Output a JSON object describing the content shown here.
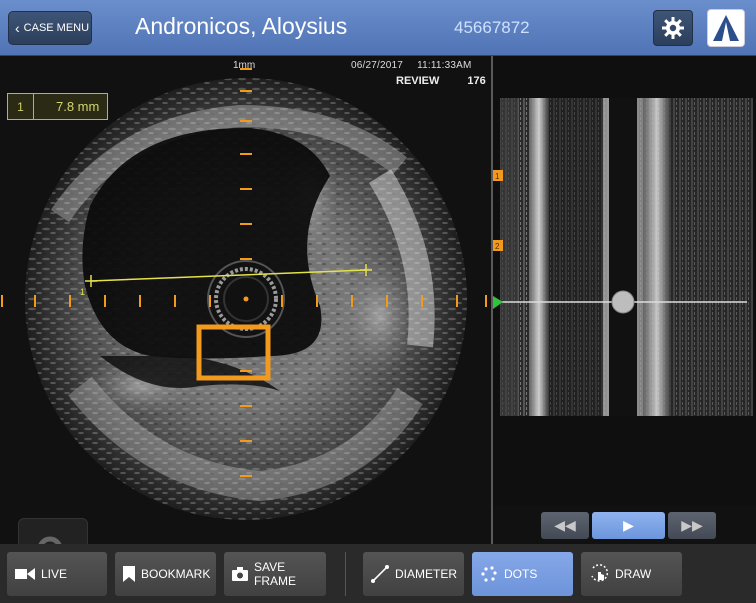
{
  "header": {
    "back_label": "CASE MENU",
    "patient_name": "Andronicos, Aloysius",
    "patient_id": "45667872"
  },
  "ivus": {
    "scale_label": "1mm",
    "date": "06/27/2017",
    "time": "11:11:33AM",
    "mode": "REVIEW",
    "frame": "176",
    "measurement": {
      "index": "1",
      "value": "7.8 mm"
    },
    "diameter_endpoint_label": "1"
  },
  "longview": {
    "bookmarks": [
      "1",
      "2"
    ]
  },
  "playback": {
    "rewind_icon": "rewind-icon",
    "play_icon": "play-icon",
    "forward_icon": "fast-forward-icon"
  },
  "toolbar": {
    "live": "LIVE",
    "bookmark": "BOOKMARK",
    "save_frame": "SAVE FRAME",
    "diameter": "DIAMETER",
    "dots": "DOTS",
    "draw": "DRAW",
    "active_tool": "DOTS"
  },
  "colors": {
    "header_blue": "#5b7fc0",
    "active_blue": "#7a9fe4",
    "measure_yellow": "#d4d66a",
    "marker_orange": "#f29a1e",
    "marker_green": "#2fc43c"
  }
}
